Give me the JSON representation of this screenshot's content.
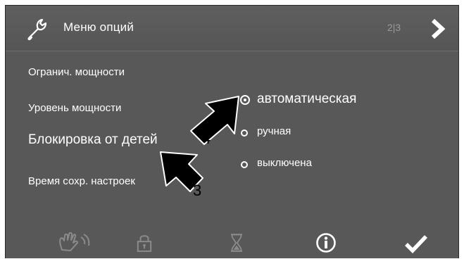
{
  "header": {
    "title": "Меню опций",
    "page_indicator": "2|3",
    "icon": "wrench-icon",
    "next_icon": "chevron-right-icon"
  },
  "menu": {
    "items": [
      {
        "label": "Огранич. мощности"
      },
      {
        "label": "Уровень мощности"
      },
      {
        "label": "Блокировка от детей"
      },
      {
        "label": "Время сохр. настроек"
      }
    ]
  },
  "options": {
    "items": [
      {
        "label": "автоматическая",
        "selected": true
      },
      {
        "label": "ручная",
        "selected": false
      },
      {
        "label": "выключена",
        "selected": false
      }
    ]
  },
  "callouts": {
    "label_3": "3",
    "label_4": "4"
  },
  "toolbar": {
    "items": [
      {
        "icon": "hand-wave-icon"
      },
      {
        "icon": "lock-icon"
      },
      {
        "icon": "hourglass-icon"
      },
      {
        "icon": "info-icon"
      },
      {
        "icon": "checkmark-icon"
      }
    ]
  },
  "colors": {
    "panel_background": "#585858",
    "text": "#ffffff",
    "page_indicator": "#9a9a9a",
    "toolbar_dim": "#8a8a8a"
  }
}
